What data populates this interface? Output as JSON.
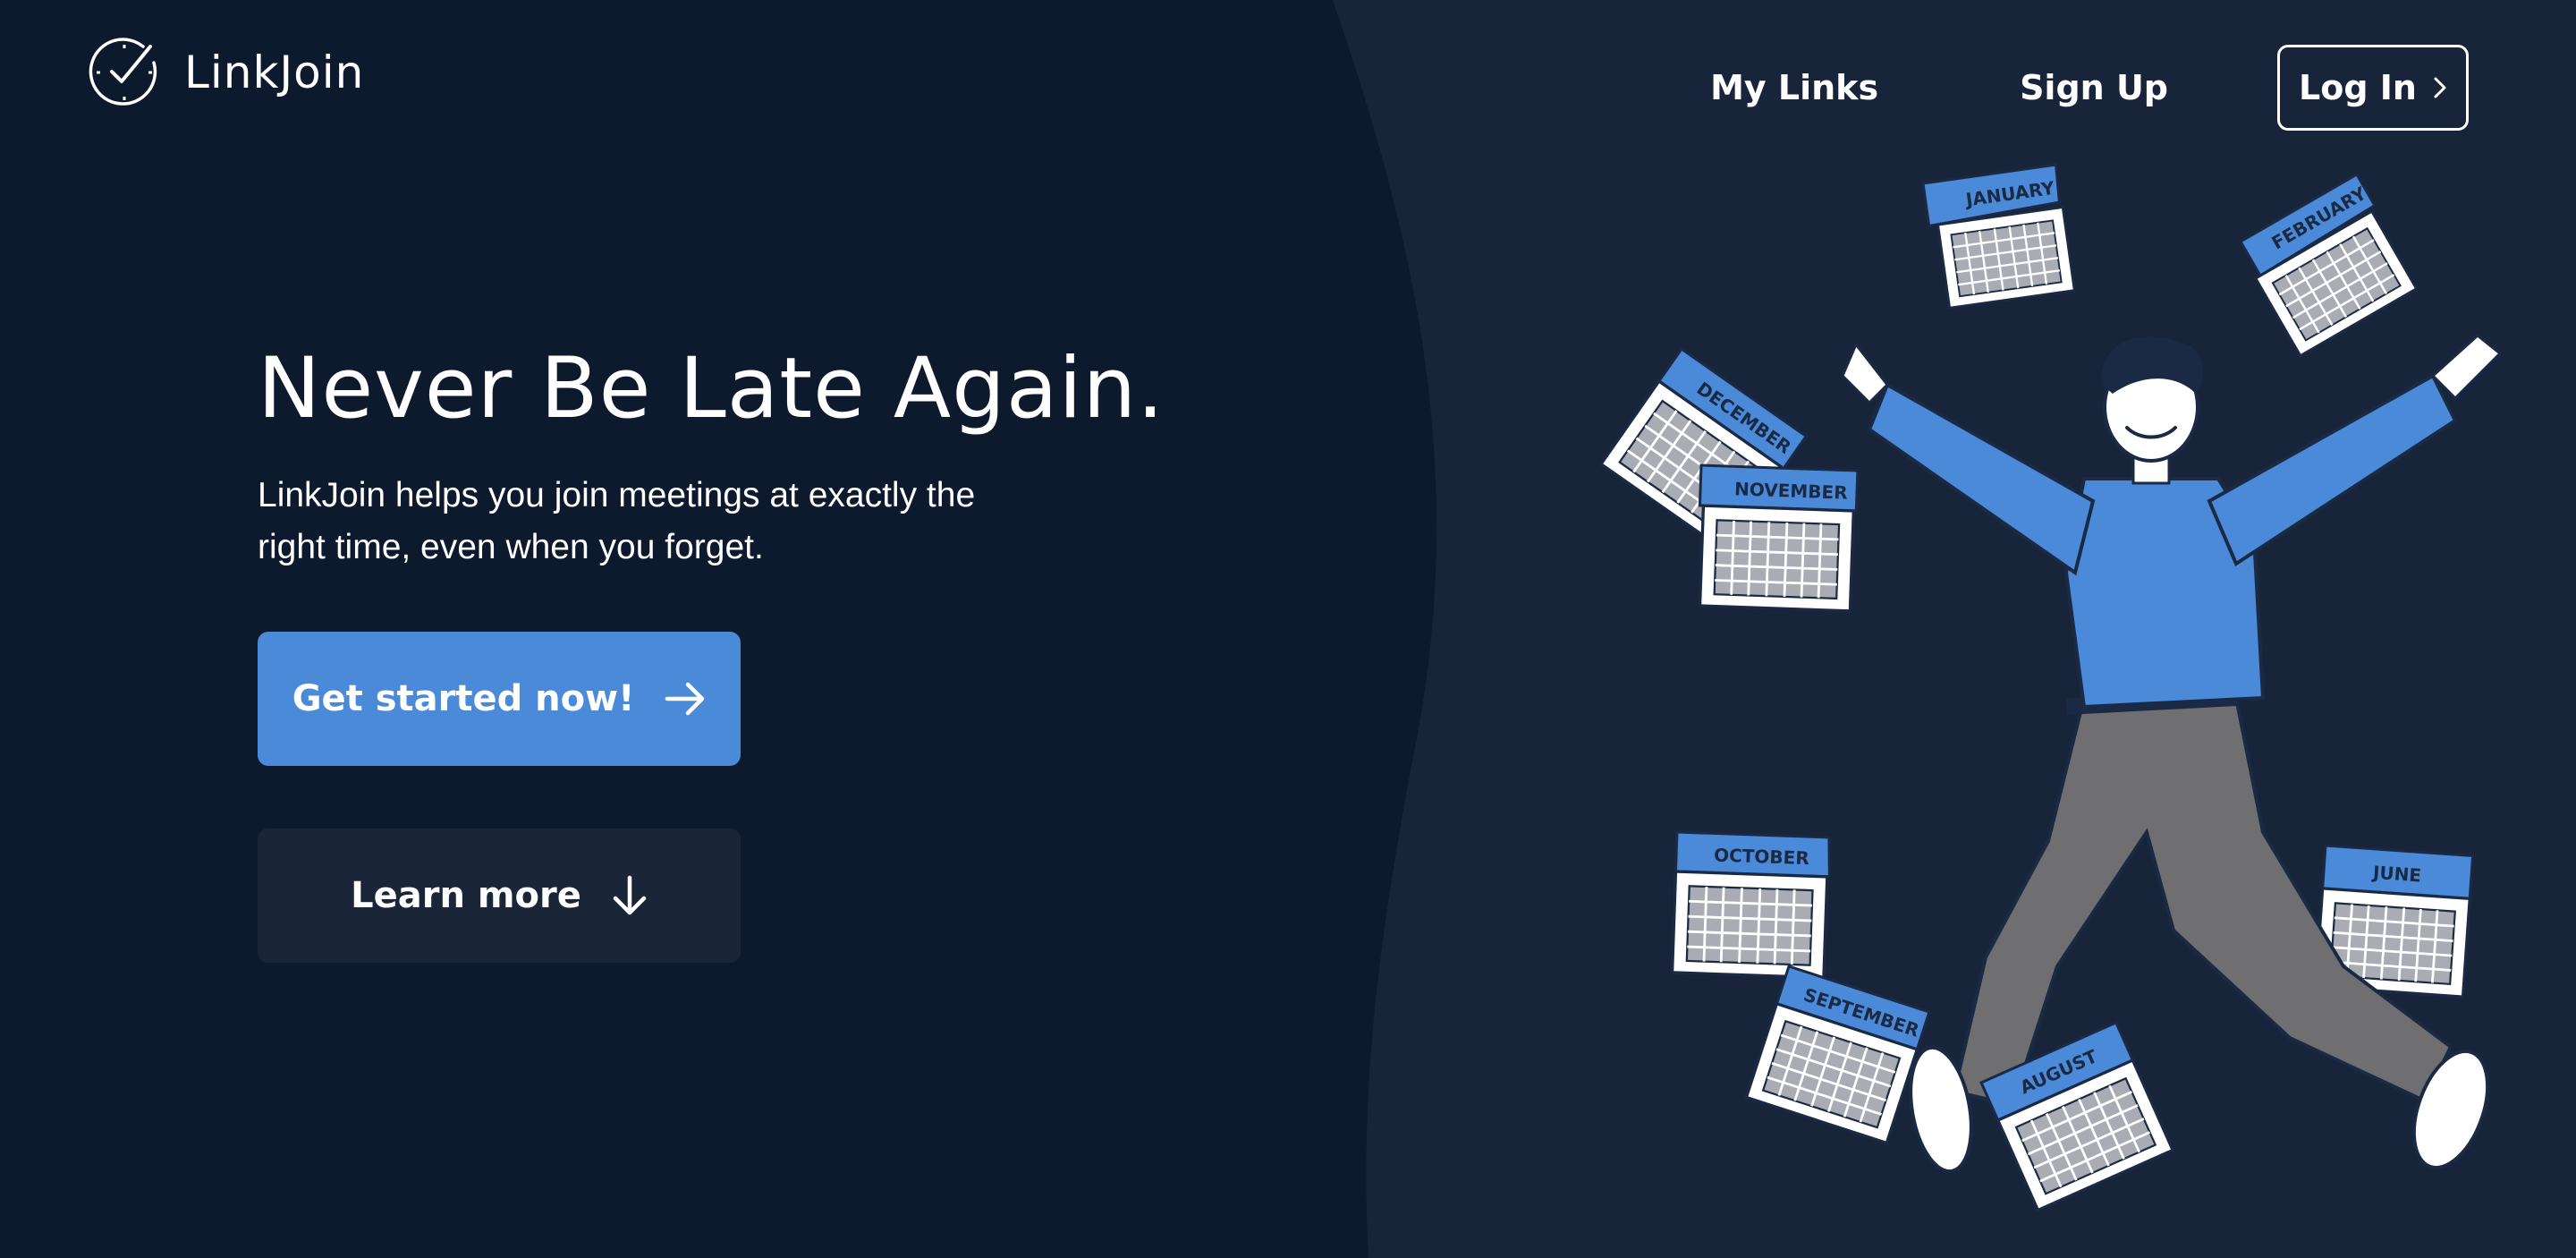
{
  "app": {
    "name": "LinkJoin",
    "logo_icon": "clock-check-icon"
  },
  "nav": {
    "my_links": "My Links",
    "sign_up": "Sign Up",
    "log_in": "Log In",
    "log_in_icon": "chevron-right-icon"
  },
  "hero": {
    "title": "Never Be Late Again.",
    "subtitle_line1": "LinkJoin helps you join meetings at exactly the",
    "subtitle_line2": "right time, even when you forget.",
    "primary_cta": "Get started now!",
    "primary_cta_icon": "arrow-right-icon",
    "secondary_cta": "Learn more",
    "secondary_cta_icon": "arrow-down-icon"
  },
  "illustration": {
    "calendar_months": [
      "JANUARY",
      "FEBRUARY",
      "DECEMBER",
      "NOVEMBER",
      "OCTOBER",
      "SEPTEMBER",
      "AUGUST",
      "JUNE"
    ]
  },
  "colors": {
    "background_left": "#0d1a2d",
    "background_right": "#18243a",
    "accent": "#4a8ad8",
    "secondary_button": "#1a2538",
    "text": "#ffffff"
  }
}
